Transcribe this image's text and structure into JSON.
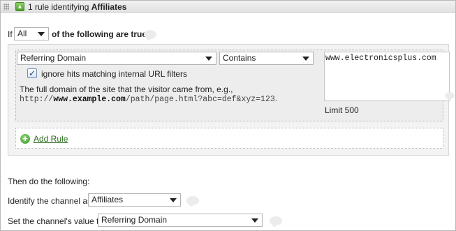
{
  "header": {
    "collapse_icon": "collapse-arrow-icon",
    "title_prefix": "1 rule identifying ",
    "title_bold": "Affiliates"
  },
  "condition": {
    "if_label": "If",
    "match_value": "All",
    "suffix_label": "of the following are true:"
  },
  "rule": {
    "field_value": "Referring Domain",
    "operator_value": "Contains",
    "checkbox_checked": true,
    "checkbox_label": "ignore hits matching internal URL filters",
    "description_line1": "The full domain of the site that the visitor came from, e.g.,",
    "example_prefix": "http://",
    "example_bold": "www.example.com",
    "example_suffix": "/path/page.html?abc=def&xyz=123",
    "example_end": ".",
    "values_text": "www.electronicsplus.com",
    "limit_label": "Limit 500"
  },
  "add_rule": {
    "icon": "plus-circle-icon",
    "label": "Add Rule"
  },
  "then": {
    "heading": "Then do the following:",
    "identify_label": "Identify the channel as",
    "identify_value": "Affiliates",
    "set_label": "Set the channel's value to",
    "set_value": "Referring Domain"
  }
}
